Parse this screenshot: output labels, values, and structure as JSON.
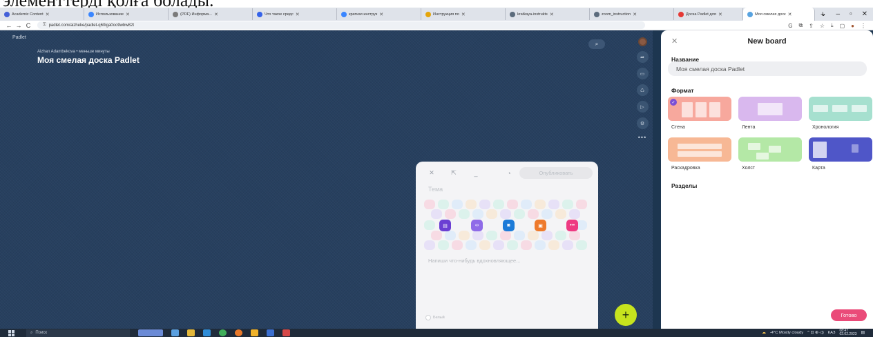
{
  "page_top_text": "элементтерді қолға болады.",
  "browser": {
    "tabs": [
      {
        "title": "Academic Content",
        "color": "#4460d8"
      },
      {
        "title": "Использование",
        "color": "#3a86ff"
      },
      {
        "title": "(PDF) Информа...",
        "color": "#7a7a7a"
      },
      {
        "title": "Что такое средс",
        "color": "#3563e9"
      },
      {
        "title": "краткая инструк",
        "color": "#3a86ff"
      },
      {
        "title": "Инструкция по",
        "color": "#e5a50a"
      },
      {
        "title": "kratkaya-instrukts",
        "color": "#5b6b7c"
      },
      {
        "title": "zoom_instruction",
        "color": "#5b6b7c"
      },
      {
        "title": "Доска Padlet для",
        "color": "#e53935"
      },
      {
        "title": "Моя смелая доск",
        "color": "#58a3e0",
        "active": true
      }
    ],
    "new_tab": "+",
    "window_controls": [
      "⌄",
      "–",
      "▫",
      "✕"
    ],
    "url": "padlet.com/aizheke/padlet-q60iga0oo9wbw82t",
    "toolbar_icons": [
      "G",
      "⧉",
      "⇪",
      "☆",
      "⤓",
      "▢",
      "●",
      "⋮"
    ]
  },
  "padlet": {
    "brand": "Padlet",
    "breadcrumb": "Aizhan Adambekova • меньше минуты",
    "board_title": "Моя смелая доска Padlet",
    "search_icon": "⌕",
    "rail_icons": [
      "➦",
      "▭",
      "♺",
      "▷",
      "⚙"
    ],
    "rail_more": "•••",
    "fab": "+"
  },
  "composer": {
    "close": "✕",
    "expand": "⇱",
    "minimize": "_",
    "preview": "◔",
    "publish": "Опубликовать",
    "topic_placeholder": "Тема",
    "body_placeholder": "Напиши что-нибудь вдохновляющее...",
    "color_label": "Белый",
    "attachments": [
      {
        "name": "file",
        "color": "#6b3fd3",
        "glyph": "▤"
      },
      {
        "name": "link",
        "color": "#8f6be8",
        "glyph": "∞"
      },
      {
        "name": "camera",
        "color": "#1d7bd8",
        "glyph": "◙"
      },
      {
        "name": "image",
        "color": "#ee7a2c",
        "glyph": "▣"
      },
      {
        "name": "more",
        "color": "#ee3a82",
        "glyph": "•••"
      }
    ]
  },
  "panel": {
    "close": "✕",
    "title": "New board",
    "name_label": "Название",
    "name_value": "Моя смелая доска Padlet",
    "format_label": "Формат",
    "formats": [
      {
        "label": "Стена",
        "color": "#f7a89d",
        "selected": true
      },
      {
        "label": "Лента",
        "color": "#d9b8ee"
      },
      {
        "label": "Хронология",
        "color": "#a6e0cf"
      },
      {
        "label": "Раскадровка",
        "color": "#f7b895"
      },
      {
        "label": "Холст",
        "color": "#b4e8a6"
      },
      {
        "label": "Карта",
        "color": "#4f56c8"
      }
    ],
    "sections_label": "Разделы",
    "done": "Готово"
  },
  "taskbar": {
    "search": "Поиск",
    "weather": "-4°C Mostly cloudy",
    "tray_icons": "^ ⊡ ⊕ ◁)",
    "lang": "КАЗ",
    "time": "08:47",
    "date": "02.02.2023",
    "app_colors": [
      "#6b8bd6",
      "#5aa0e0",
      "#e4b83a",
      "#2f8dd8",
      "#3fae5a",
      "#e8792a",
      "#f0b22a",
      "#3b6fd0",
      "#d64848"
    ]
  }
}
